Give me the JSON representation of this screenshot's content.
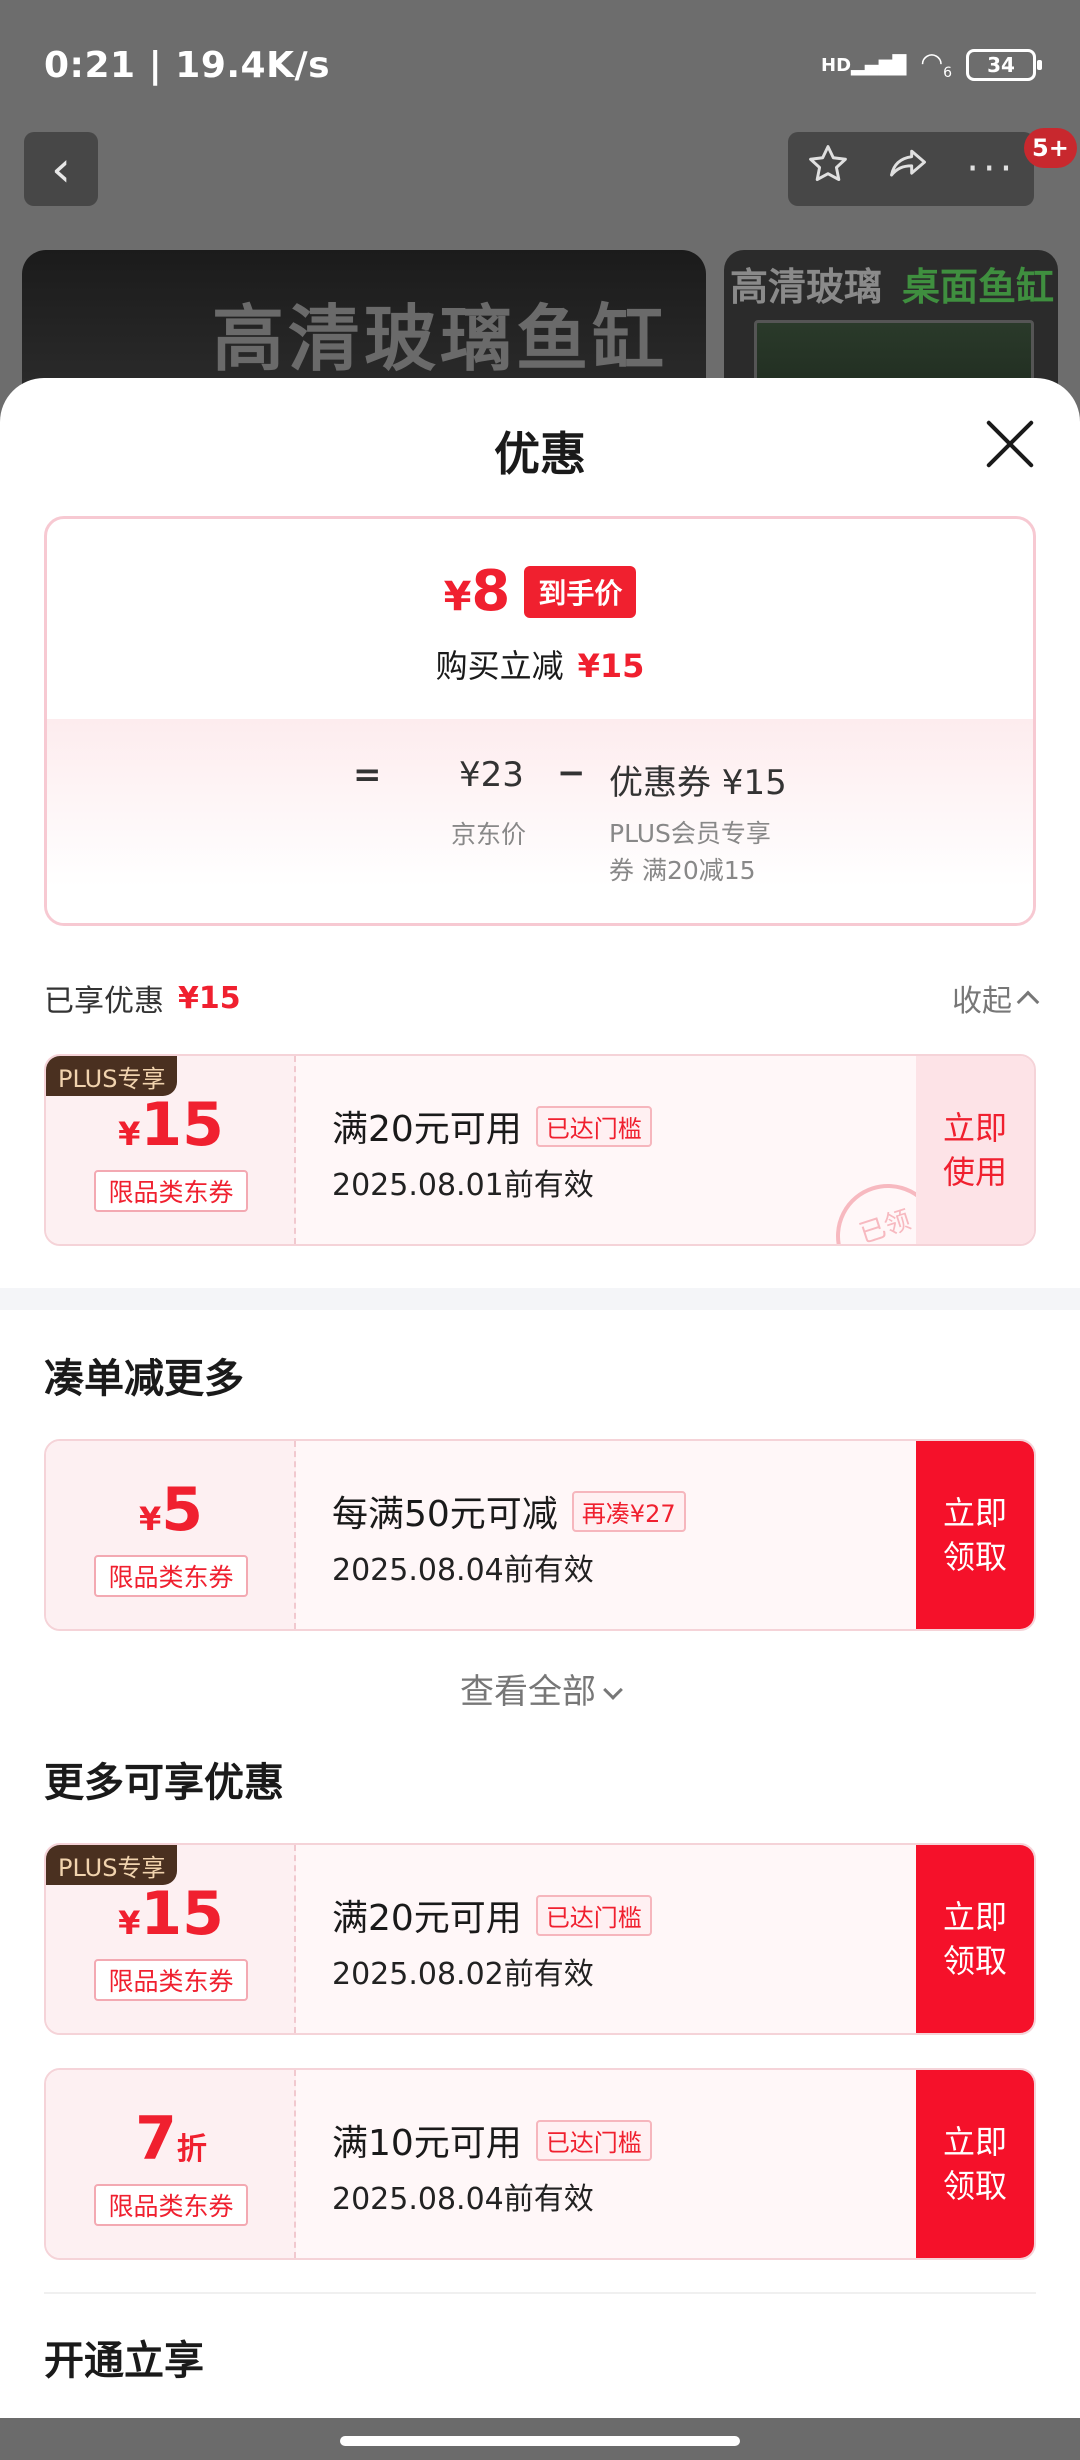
{
  "status": {
    "time": "0:21",
    "speed": "19.4K/s",
    "net": "HD",
    "wifi_label": "6",
    "battery": "34"
  },
  "nav": {
    "badge": "5+"
  },
  "background": {
    "banner_text": "高清玻璃鱼缸",
    "side_text1": "高清玻璃",
    "side_text2": "桌面鱼缸"
  },
  "sheet": {
    "title": "优惠"
  },
  "summary": {
    "currency": "¥",
    "final_price": "8",
    "final_tag": "到手价",
    "reduce_label": "购买立减",
    "reduce_amount": "¥15",
    "eq": "=",
    "jd_price": "¥23",
    "minus": "−",
    "coupon_label": "优惠券 ¥15",
    "jd_price_label": "京东价",
    "coupon_desc": "PLUS会员专享券 满20减15"
  },
  "enjoyed": {
    "label": "已享优惠",
    "amount": "¥15",
    "collapse": "收起"
  },
  "applied_coupon": {
    "plus_tag": "PLUS专享",
    "currency": "¥",
    "amount": "15",
    "type": "限品类东券",
    "condition": "满20元可用",
    "tag": "已达门槛",
    "date": "2025.08.01前有效",
    "button": "立即使用",
    "stamp": "已领"
  },
  "section1": {
    "title": "凑单减更多"
  },
  "coupon_more": {
    "currency": "¥",
    "amount": "5",
    "type": "限品类东券",
    "condition": "每满50元可减",
    "tag": "再凑¥27",
    "date": "2025.08.04前有效",
    "button": "立即领取"
  },
  "view_all": "查看全部",
  "section2": {
    "title": "更多可享优惠"
  },
  "coupon_plus": {
    "plus_tag": "PLUS专享",
    "currency": "¥",
    "amount": "15",
    "type": "限品类东券",
    "condition": "满20元可用",
    "tag": "已达门槛",
    "date": "2025.08.02前有效",
    "button": "立即领取"
  },
  "coupon_discount": {
    "amount": "7",
    "unit": "折",
    "type": "限品类东券",
    "condition": "满10元可用",
    "tag": "已达门槛",
    "date": "2025.08.04前有效",
    "button": "立即领取"
  },
  "section3": {
    "title": "开通立享"
  }
}
